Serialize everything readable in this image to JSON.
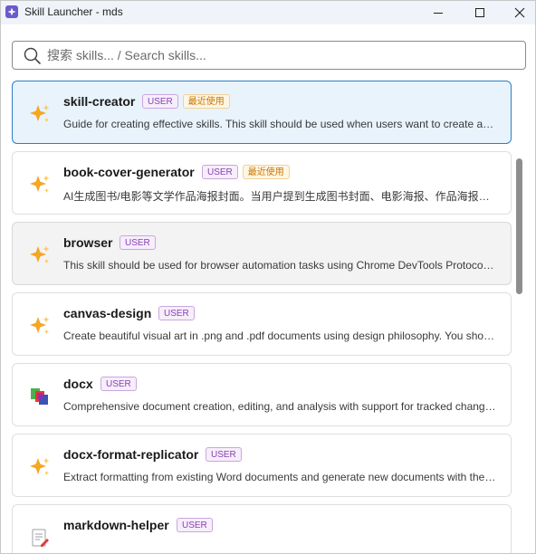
{
  "window": {
    "title": "Skill Launcher - mds"
  },
  "search": {
    "placeholder": "搜索 skills... / Search skills...",
    "value": ""
  },
  "badges": {
    "user": "USER",
    "recent": "最近使用"
  },
  "skills": [
    {
      "name": "skill-creator",
      "icon": "sparkle-icon",
      "user": true,
      "recent": true,
      "state": "selected",
      "description": "Guide for creating effective skills. This skill should be used when users want to create a new skill (or update an existing skill)"
    },
    {
      "name": "book-cover-generator",
      "icon": "sparkle-icon",
      "user": true,
      "recent": true,
      "state": "normal",
      "description": "AI生成图书/电影等文学作品海报封面。当用户提到生成图书封面、电影海报、作品海报时使用"
    },
    {
      "name": "browser",
      "icon": "sparkle-icon",
      "user": true,
      "recent": false,
      "state": "hovered",
      "description": "This skill should be used for browser automation tasks using Chrome DevTools Protocol (CDP)"
    },
    {
      "name": "canvas-design",
      "icon": "sparkle-icon",
      "user": true,
      "recent": false,
      "state": "normal",
      "description": "Create beautiful visual art in .png and .pdf documents using design philosophy. You should use this skill"
    },
    {
      "name": "docx",
      "icon": "docx-icon",
      "user": true,
      "recent": false,
      "state": "normal",
      "description": "Comprehensive document creation, editing, and analysis with support for tracked changes, comments"
    },
    {
      "name": "docx-format-replicator",
      "icon": "sparkle-icon",
      "user": true,
      "recent": false,
      "state": "normal",
      "description": "Extract formatting from existing Word documents and generate new documents with the same format"
    },
    {
      "name": "markdown-helper",
      "icon": "document-edit-icon",
      "user": true,
      "recent": false,
      "state": "normal",
      "description": ""
    }
  ],
  "colors": {
    "accent": "#2f7fc2",
    "selected_bg": "#e8f3fc",
    "user_badge": "#8a3fb3",
    "recent_badge": "#c77700",
    "sparkle": "#f5a623"
  }
}
